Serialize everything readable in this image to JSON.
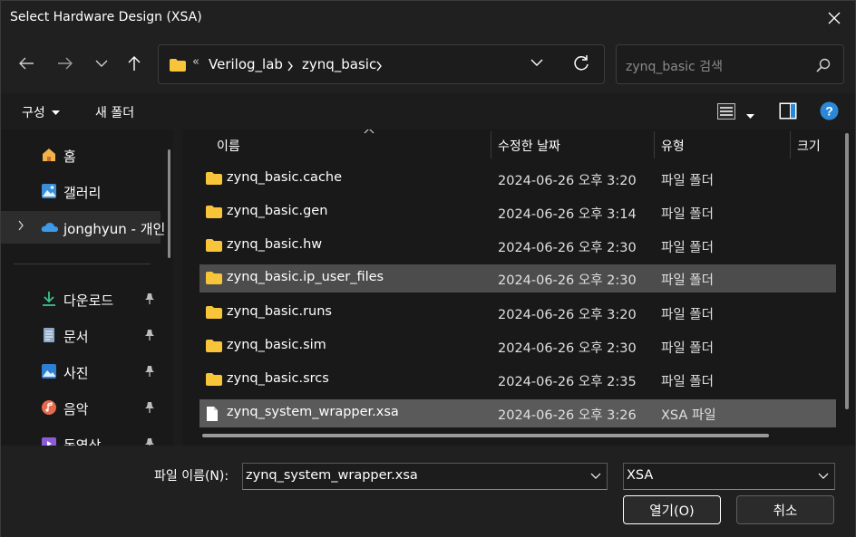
{
  "window": {
    "title": "Select Hardware Design (XSA)"
  },
  "address": {
    "segments": [
      "Verilog_lab",
      "zynq_basic"
    ],
    "overflow": "«"
  },
  "search": {
    "placeholder": "zynq_basic 검색"
  },
  "toolbar": {
    "organize_label": "구성",
    "new_folder_label": "새 폴더"
  },
  "sidebar": {
    "items": [
      {
        "label": "홈",
        "icon": "home-icon"
      },
      {
        "label": "갤러리",
        "icon": "gallery-icon"
      },
      {
        "label": "jonghyun - 개인",
        "icon": "onedrive-icon"
      },
      {
        "label": "다운로드",
        "icon": "download-icon"
      },
      {
        "label": "문서",
        "icon": "document-icon"
      },
      {
        "label": "사진",
        "icon": "pictures-icon"
      },
      {
        "label": "음악",
        "icon": "music-icon"
      },
      {
        "label": "동영상",
        "icon": "videos-icon"
      }
    ]
  },
  "columns": {
    "name": "이름",
    "modified": "수정한 날짜",
    "type": "유형",
    "size": "크기"
  },
  "files": [
    {
      "name": "zynq_basic.cache",
      "modified": "2024-06-26 오후 3:20",
      "type": "파일 폴더",
      "kind": "folder"
    },
    {
      "name": "zynq_basic.gen",
      "modified": "2024-06-26 오후 3:14",
      "type": "파일 폴더",
      "kind": "folder"
    },
    {
      "name": "zynq_basic.hw",
      "modified": "2024-06-26 오후 2:30",
      "type": "파일 폴더",
      "kind": "folder"
    },
    {
      "name": "zynq_basic.ip_user_files",
      "modified": "2024-06-26 오후 2:30",
      "type": "파일 폴더",
      "kind": "folder"
    },
    {
      "name": "zynq_basic.runs",
      "modified": "2024-06-26 오후 3:20",
      "type": "파일 폴더",
      "kind": "folder"
    },
    {
      "name": "zynq_basic.sim",
      "modified": "2024-06-26 오후 2:30",
      "type": "파일 폴더",
      "kind": "folder"
    },
    {
      "name": "zynq_basic.srcs",
      "modified": "2024-06-26 오후 2:35",
      "type": "파일 폴더",
      "kind": "folder"
    },
    {
      "name": "zynq_system_wrapper.xsa",
      "modified": "2024-06-26 오후 3:26",
      "type": "XSA 파일",
      "kind": "file"
    }
  ],
  "bottom": {
    "filename_label": "파일 이름(N):",
    "filename_value": "zynq_system_wrapper.xsa",
    "filter_value": "XSA",
    "open_label": "열기(O)",
    "cancel_label": "취소"
  },
  "colors": {
    "accent": "#0078d4",
    "folder": "#f8c53a",
    "help": "#2b88d8"
  }
}
